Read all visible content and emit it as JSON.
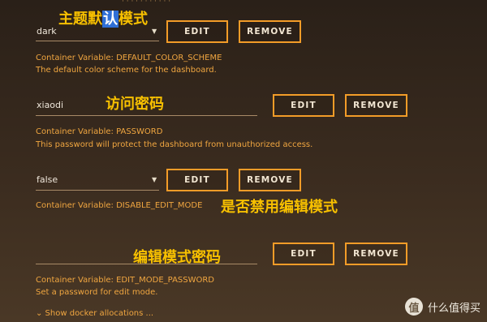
{
  "fields": [
    {
      "value": "dark",
      "edit_label": "EDIT",
      "remove_label": "REMOVE",
      "variable_label": "Container Variable: DEFAULT_COLOR_SCHEME",
      "description": "The default color scheme for the dashboard.",
      "annotation_pre": "主题默",
      "annotation_hl": "认",
      "annotation_post": "模式",
      "type": "select"
    },
    {
      "value": "xiaodi",
      "edit_label": "EDIT",
      "remove_label": "REMOVE",
      "variable_label": "Container Variable: PASSWORD",
      "description": "This password will protect the dashboard from unauthorized access.",
      "annotation": "访问密码",
      "type": "text"
    },
    {
      "value": "false",
      "edit_label": "EDIT",
      "remove_label": "REMOVE",
      "variable_label": "Container Variable: DISABLE_EDIT_MODE",
      "annotation": "是否禁用编辑模式",
      "type": "select"
    },
    {
      "value": "",
      "edit_label": "EDIT",
      "remove_label": "REMOVE",
      "variable_label": "Container Variable: EDIT_MODE_PASSWORD",
      "description": "Set a password for edit mode.",
      "annotation": "编辑模式密码",
      "type": "text"
    }
  ],
  "show_docker": "⌄ Show docker allocations ...",
  "watermark": {
    "badge": "值",
    "text": "什么值得买"
  }
}
